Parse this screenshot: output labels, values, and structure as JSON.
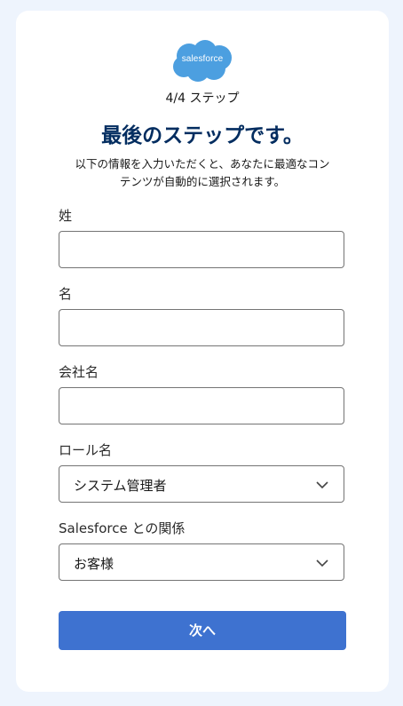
{
  "logo": {
    "text": "salesforce",
    "color": "#4c9fe0"
  },
  "progress": {
    "step_text": "4/4 ステップ",
    "current": 4,
    "total": 4
  },
  "title": "最後のステップです。",
  "description": {
    "line1": "以下の情報を入力いただくと、あなたに最適なコン",
    "line2": "テンツが自動的に選択されます。"
  },
  "form": {
    "last_name": {
      "label": "姓",
      "value": ""
    },
    "first_name": {
      "label": "名",
      "value": ""
    },
    "company": {
      "label": "会社名",
      "value": ""
    },
    "role": {
      "label": "ロール名",
      "value": "システム管理者"
    },
    "relationship": {
      "label": "Salesforce との関係",
      "value": "お客様"
    }
  },
  "next_button": {
    "label": "次へ",
    "color": "#3e72d0"
  },
  "colors": {
    "title": "#032d60",
    "background": "#eef4fd"
  }
}
